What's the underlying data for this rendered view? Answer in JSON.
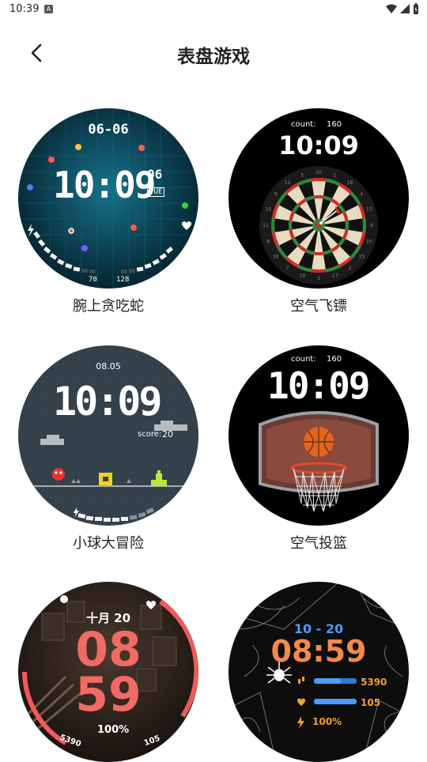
{
  "status_bar": {
    "time": "10:39",
    "notification_icon": "A"
  },
  "header": {
    "title": "表盘游戏"
  },
  "games": [
    {
      "name": "腕上贪吃蛇",
      "date": "06-06",
      "time": "10:09",
      "seconds": "06",
      "weekday": "TUE",
      "bottom_left": "70",
      "bottom_right": "128"
    },
    {
      "name": "空气飞镖",
      "count_label": "count:",
      "count": "160",
      "time": "10:09",
      "dart_numbers": [
        "20",
        "1",
        "18",
        "4",
        "13",
        "6",
        "10",
        "15",
        "2",
        "17",
        "3",
        "19",
        "7",
        "16",
        "8",
        "11",
        "14",
        "9",
        "12",
        "5"
      ]
    },
    {
      "name": "小球大冒险",
      "date": "08.05",
      "time": "10:09",
      "score_label": "score:",
      "score": "20"
    },
    {
      "name": "空气投篮",
      "count_label": "count:",
      "count": "160",
      "time": "10:09"
    },
    {
      "name": "",
      "date": "十月 20",
      "hour": "08",
      "minute": "59",
      "battery": "100%",
      "steps": "5390",
      "heart": "105"
    },
    {
      "name": "",
      "date": "10 - 20",
      "time": "08:59",
      "steps": "5390",
      "heart": "105",
      "battery": "100%"
    }
  ]
}
